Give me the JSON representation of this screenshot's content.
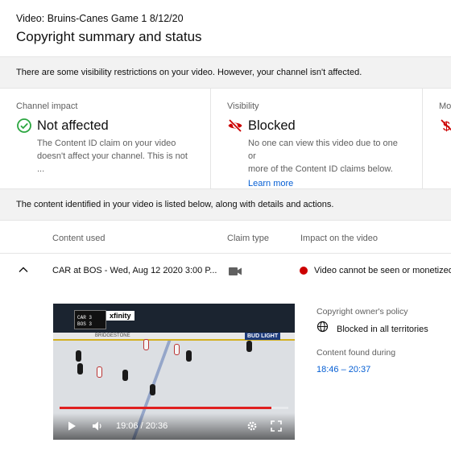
{
  "header": {
    "video_label": "Video: Bruins-Canes Game 1 8/12/20",
    "title": "Copyright summary and status"
  },
  "banner": {
    "text": "There are some visibility restrictions on your video. However, your channel isn't affected."
  },
  "cards": [
    {
      "label": "Channel impact",
      "status": "Not affected",
      "icon": "check-circle-icon",
      "description_line1": "The Content ID claim on your video",
      "description_line2": "doesn't affect your channel. This is not ..."
    },
    {
      "label": "Visibility",
      "status": "Blocked",
      "icon": "eye-off-icon",
      "description_line1": "No one can view this video due to one or",
      "description_line2": "more of the Content ID claims below.",
      "link": "Learn more"
    },
    {
      "label": "Mo",
      "icon": "no-money-icon"
    }
  ],
  "info": {
    "text": "The content identified in your video is listed below, along with details and actions."
  },
  "table": {
    "headers": [
      "Content used",
      "Claim type",
      "Impact on the video"
    ],
    "row": {
      "content": "CAR at BOS - Wed, Aug 12 2020 3:00 P...",
      "claim_icon": "video-camera-icon",
      "impact": "Video cannot be seen or monetized"
    }
  },
  "player": {
    "current_time": "19:06 / 20:36",
    "progress": 0.927,
    "sponsor": "xfinity",
    "score_rows": [
      "CAR 3",
      "BOS 3"
    ],
    "board_ad": "BUD LIGHT",
    "ad_text": "BRIDGESTONE"
  },
  "details": {
    "policy_label": "Copyright owner's policy",
    "policy_value": "Blocked in all territories",
    "found_label": "Content found during",
    "found_value": "18:46 – 20:37"
  },
  "colors": {
    "accent_blue": "#065fd4",
    "check_green": "#2ba640",
    "blocked_red": "#cc0000",
    "panel_gray": "#f2f2f2"
  }
}
